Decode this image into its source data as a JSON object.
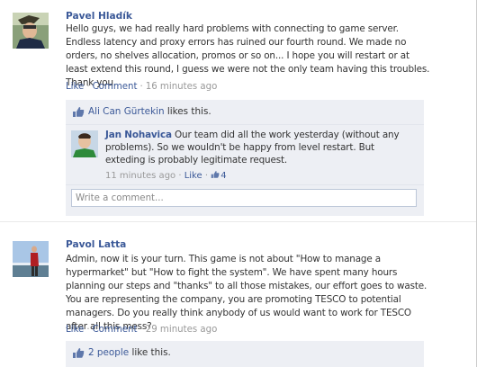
{
  "posts": [
    {
      "author": "Pavel Hladík",
      "message": "Hello guys, we had really hard problems with connecting to game server. Endless latency and proxy errors has ruined our fourth round. We made no orders, no shelves allocation, promos or so on... I hope you will restart or at least extend this round, I guess we were not the only team having this troubles. Thank you.",
      "like_label": "Like",
      "comment_label": "Comment",
      "time": "16 minutes ago",
      "likes": {
        "liker": "Ali Can Gürtekin",
        "suffix": " likes this.",
        "icon": "thumbs-up-icon"
      },
      "comments": [
        {
          "author": "Jan Nohavica",
          "text": "Our team did all the work yesterday (without any problems). So we wouldn't be happy from level restart. But exteding is probably legitimate request.",
          "time": "11 minutes ago",
          "like_label": "Like",
          "like_count": "4"
        }
      ],
      "write_placeholder": "Write a comment..."
    },
    {
      "author": "Pavol Latta",
      "message": "Admin, now it is your turn. This game is not about \"How to manage a hypermarket\" but \"How to fight the system\". We have spent many hours planning our steps and \"thanks\" to all those mistakes, our effort goes to waste. You are representing the company, you are promoting TESCO to potential managers. Do you really think anybody of us would want to work for TESCO after all this mess?",
      "like_label": "Like",
      "comment_label": "Comment",
      "time": "29 minutes ago",
      "likes": {
        "liker": "2 people",
        "suffix": " like this.",
        "icon": "thumbs-up-icon"
      }
    }
  ],
  "colors": {
    "link": "#3b5998",
    "ufi_bg": "#edeff4",
    "meta": "#999999"
  }
}
